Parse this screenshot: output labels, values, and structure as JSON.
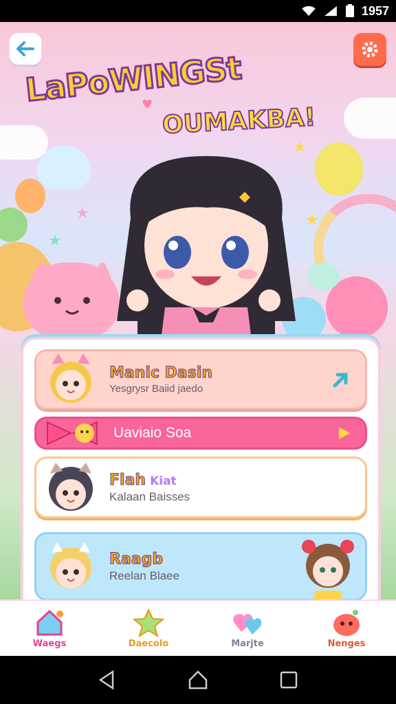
{
  "status_bar": {
    "time": "1957",
    "icons": [
      "wifi-icon",
      "signal-icon",
      "battery-icon"
    ]
  },
  "header": {
    "title_line_1": "LaPoWINGSt",
    "title_line_2": "OUMAKBA!",
    "back_icon": "back-arrow-icon",
    "settings_icon": "gear-icon"
  },
  "list": {
    "items": [
      {
        "name": "Manic Dasin",
        "subtitle": "Yesgrysr Baiid jaedo",
        "action_icon": "arrow-icon"
      },
      {
        "label": "Uaviaio Soa",
        "action_icon": "play-icon"
      },
      {
        "name": "Flah",
        "tag": "Kiat",
        "subtitle": "Kalaan Baisses"
      },
      {
        "name": "Raagb",
        "subtitle": "Reelan Blaee"
      }
    ]
  },
  "bottom_nav": {
    "items": [
      {
        "label": "Waegs",
        "icon": "house-icon",
        "color": "#e0448a"
      },
      {
        "label": "Daecolo",
        "icon": "star-icon",
        "color": "#e89a1c"
      },
      {
        "label": "Marjte",
        "icon": "hearts-icon",
        "color": "#8a7a9a"
      },
      {
        "label": "Nenges",
        "icon": "slime-icon",
        "color": "#e8552e"
      }
    ]
  },
  "colors": {
    "accent_pink": "#f9659a",
    "settings_orange": "#ff6b4a",
    "panel_border": "#f7cfe0"
  }
}
